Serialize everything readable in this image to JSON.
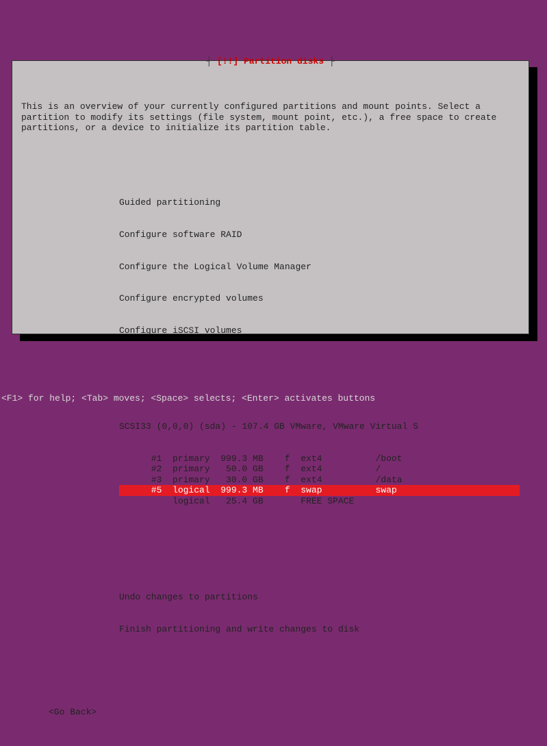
{
  "title": {
    "left_bracket": "┤ ",
    "marker": "[!!]",
    "text": " Partition disks",
    "right_bracket": " ├"
  },
  "intro": "This is an overview of your currently configured partitions and mount points. Select a partition to modify its settings (file system, mount point, etc.), a free space to create partitions, or a device to initialize its partition table.",
  "menu": {
    "guided": "Guided partitioning",
    "raid": "Configure software RAID",
    "lvm": "Configure the Logical Volume Manager",
    "encrypted": "Configure encrypted volumes",
    "iscsi": "Configure iSCSI volumes"
  },
  "disk_header": "SCSI33 (0,0,0) (sda) - 107.4 GB VMware, VMware Virtual S",
  "partitions": [
    {
      "num": "#1",
      "type": "primary",
      "size": "999.3 MB",
      "flag": "f",
      "fs": "ext4",
      "mount": "/boot",
      "selected": false
    },
    {
      "num": "#2",
      "type": "primary",
      "size": " 50.0 GB",
      "flag": "f",
      "fs": "ext4",
      "mount": "/",
      "selected": false
    },
    {
      "num": "#3",
      "type": "primary",
      "size": " 30.0 GB",
      "flag": "f",
      "fs": "ext4",
      "mount": "/data",
      "selected": false
    },
    {
      "num": "#5",
      "type": "logical",
      "size": "999.3 MB",
      "flag": "f",
      "fs": "swap",
      "mount": "swap",
      "selected": true
    },
    {
      "num": "  ",
      "type": "logical",
      "size": " 25.4 GB",
      "flag": " ",
      "fs": "FREE SPACE",
      "mount": "",
      "selected": false
    }
  ],
  "actions": {
    "undo": "Undo changes to partitions",
    "finish": "Finish partitioning and write changes to disk"
  },
  "go_back": "<Go Back>",
  "footer": "<F1> for help; <Tab> moves; <Space> selects; <Enter> activates buttons"
}
